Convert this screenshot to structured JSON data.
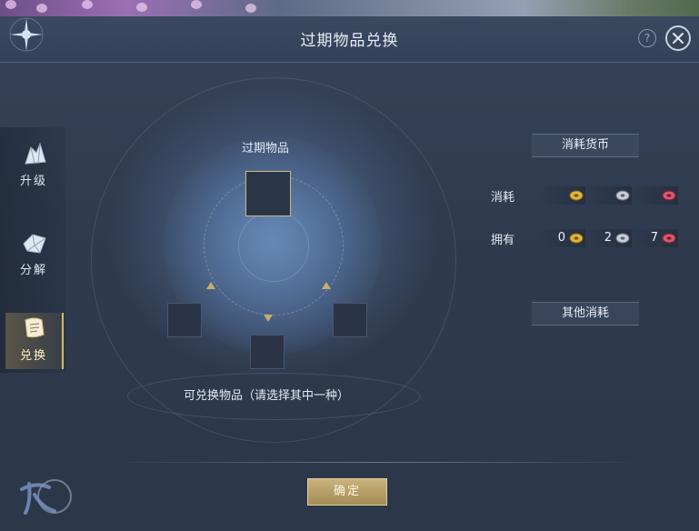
{
  "window": {
    "title": "过期物品兑换",
    "help_label": "?"
  },
  "sidebar": {
    "items": [
      {
        "label": "升级",
        "icon": "crystal-upgrade-icon",
        "active": false
      },
      {
        "label": "分解",
        "icon": "crystal-decompose-icon",
        "active": false
      },
      {
        "label": "兑换",
        "icon": "scroll-exchange-icon",
        "active": true
      }
    ]
  },
  "exchange": {
    "expired_item_label": "过期物品",
    "redeemable_label": "可兑换物品（请选择其中一种）"
  },
  "currency_panel": {
    "header": "消耗货币",
    "cost_label": "消耗",
    "owned_label": "拥有",
    "cost_values": [
      "",
      "",
      ""
    ],
    "owned_values": [
      "0",
      "2",
      "7"
    ],
    "coin_colors": [
      "#e2b43a",
      "#c9ced6",
      "#d9586e"
    ],
    "other_header": "其他消耗"
  },
  "footer": {
    "confirm_label": "确定"
  }
}
